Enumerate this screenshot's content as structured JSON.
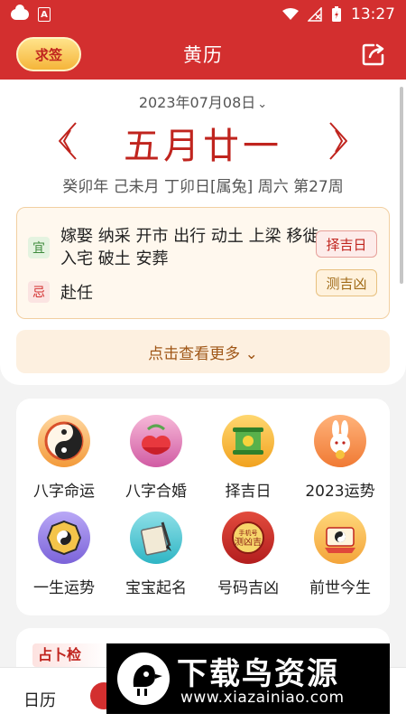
{
  "status_bar": {
    "time": "13:27"
  },
  "app_bar": {
    "title": "黄历",
    "left_button_label": "求签"
  },
  "date_picker": {
    "date": "2023年07月08日",
    "chevron": "⌄"
  },
  "lunar": {
    "date": "五月廿一"
  },
  "ganzhi": {
    "text": "癸卯年 己未月 丁卯日[属兔] 周六 第27周"
  },
  "yiji": {
    "yi_tag": "宜",
    "yi_text": "嫁娶 纳采 开市 出行 动土 上梁 移徙 入宅 破土 安葬",
    "ji_tag": "忌",
    "ji_text": "赴任",
    "buttons": [
      "择吉日",
      "测吉凶"
    ]
  },
  "more": {
    "label": "点击查看更多 ⌄"
  },
  "grid": {
    "items": [
      {
        "label": "八字命运",
        "icon": "bazi-mingyun-icon"
      },
      {
        "label": "八字合婚",
        "icon": "bazi-hehun-icon"
      },
      {
        "label": "择吉日",
        "icon": "zejiri-scroll-icon"
      },
      {
        "label": "2023运势",
        "icon": "rabbit-icon"
      },
      {
        "label": "一生运势",
        "icon": "bagua-icon"
      },
      {
        "label": "宝宝起名",
        "icon": "brush-book-icon"
      },
      {
        "label": "号码吉凶",
        "icon": "phone-number-icon"
      },
      {
        "label": "前世今生",
        "icon": "past-life-icon"
      }
    ]
  },
  "bottom_card": {
    "banner_text": "占卜检"
  },
  "tab_bar": {
    "tab_calendar": "日历"
  },
  "watermark": {
    "title": "下载鸟资源",
    "url": "www.xiazainiao.com"
  },
  "colors": {
    "primary": "#d32f2f",
    "lunar_red": "#c0241e",
    "accent_orange": "#a05718"
  }
}
